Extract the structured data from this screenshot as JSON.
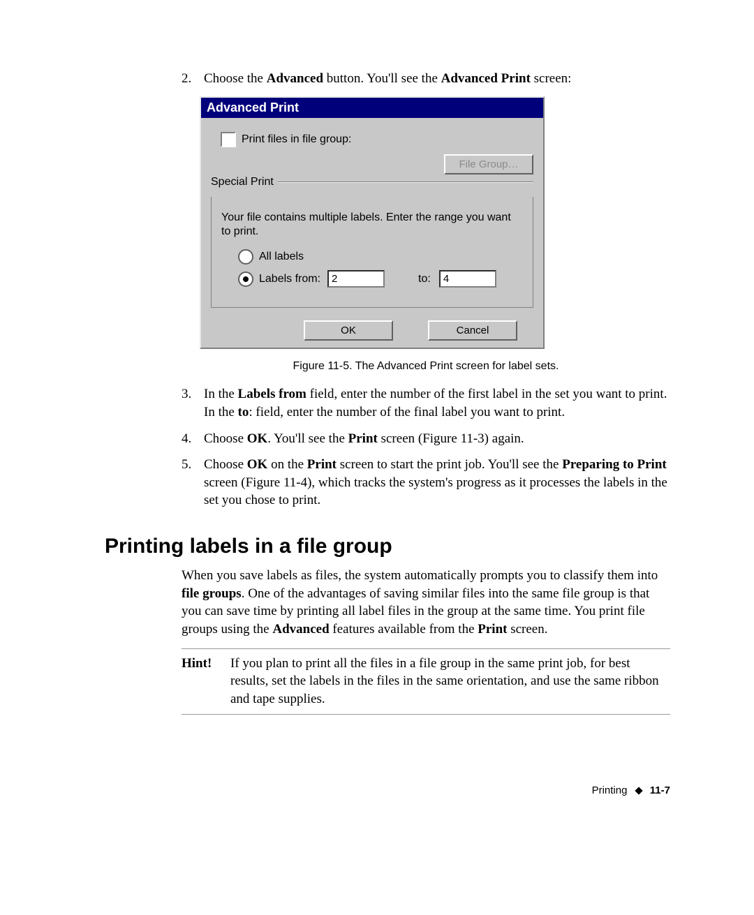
{
  "steps": {
    "s2": {
      "num": "2.",
      "pre": "Choose the ",
      "b1": "Advanced",
      "mid": " button. You'll see the ",
      "b2": "Advanced Print",
      "post": " screen:"
    },
    "s3": {
      "num": "3.",
      "pre": "In the ",
      "b1": "Labels from",
      "mid1": " field, enter the number of the first label in the set you want to print. In the ",
      "b2": "to",
      "mid2": ": field, enter the number of the final label you want to print."
    },
    "s4": {
      "num": "4.",
      "pre": "Choose ",
      "b1": "OK",
      "mid": ". You'll see the ",
      "b2": "Print",
      "post": " screen (Figure 11-3) again."
    },
    "s5": {
      "num": "5.",
      "pre": "Choose ",
      "b1": "OK",
      "mid1": " on the ",
      "b2": "Print",
      "mid2": " screen to start the print job. You'll see the ",
      "b3": "Preparing to Print",
      "post": " screen (Figure 11-4), which tracks the system's progress as it processes the labels in the set you chose to print."
    }
  },
  "dialog": {
    "title": "Advanced Print",
    "print_files_checkbox_label": "Print files in file group:",
    "file_group_button": "File Group…",
    "special_print_legend": "Special Print",
    "special_print_hint": "Your file contains multiple labels. Enter the range you want to print.",
    "all_labels_label": "All labels",
    "labels_from_label": "Labels from:",
    "from_value": "2",
    "to_label": "to:",
    "to_value": "4",
    "ok_button": "OK",
    "cancel_button": "Cancel"
  },
  "caption": "Figure 11-5. The Advanced Print screen for label sets.",
  "section_heading": "Printing labels in a file group",
  "paragraph": {
    "pre": "When you save labels as files, the system automatically prompts you to classify them into ",
    "b1": "file groups",
    "mid": ". One of the advantages of saving similar files into the same file group is that you can save time by printing all label files in the group at the same time. You print file groups using the ",
    "b2": "Advanced",
    "mid2": " features available from the ",
    "b3": "Print",
    "post": " screen."
  },
  "hint": {
    "label": "Hint!",
    "text": "If you plan to print all the files in a file group in the same print job, for best results, set the labels in the files in the same orientation, and use the same ribbon and tape supplies."
  },
  "footer": {
    "chapter": "Printing",
    "page": "11-7"
  }
}
